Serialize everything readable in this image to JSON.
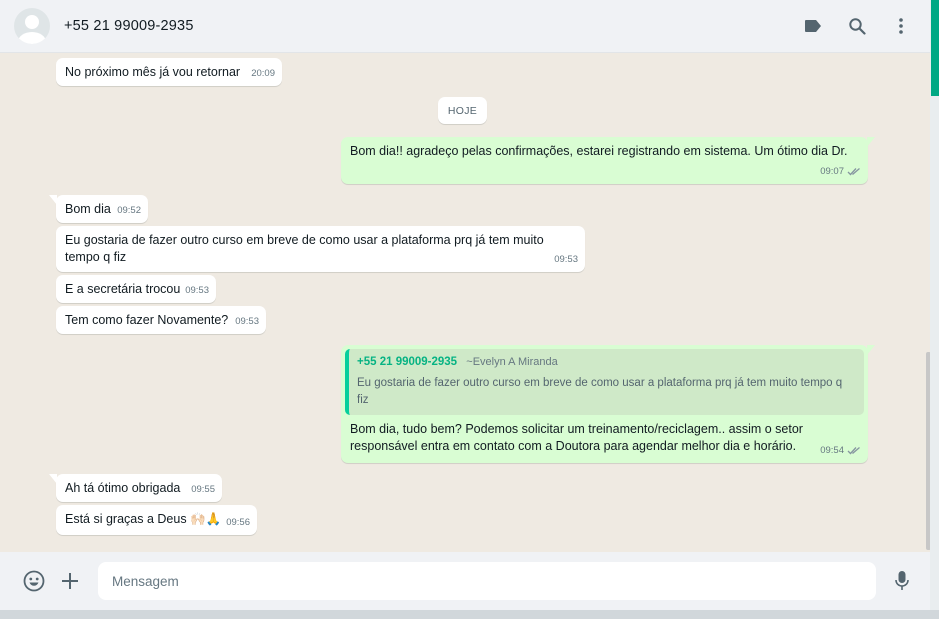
{
  "header": {
    "contact": "+55 21 99009-2935",
    "icons": [
      "label-icon",
      "search-icon",
      "menu-dots-icon"
    ]
  },
  "date_divider": "HOJE",
  "messages": [
    {
      "dir": "in",
      "text": "No próximo mês já vou retornar",
      "time": "20:09"
    },
    {
      "dir": "out",
      "text": "Bom dia!! agradeço pelas confirmações, estarei registrando em sistema. Um ótimo dia Dr.",
      "time": "09:07",
      "status": "read"
    },
    {
      "dir": "in",
      "text": "Bom dia",
      "time": "09:52"
    },
    {
      "dir": "in",
      "text": "Eu gostaria de fazer outro curso em breve de como usar a plataforma prq já tem muito tempo q fiz",
      "time": "09:53"
    },
    {
      "dir": "in",
      "text": "E a secretária trocou",
      "time": "09:53"
    },
    {
      "dir": "in",
      "text": "Tem como fazer Novamente?",
      "time": "09:53"
    },
    {
      "dir": "out",
      "quote": {
        "author": "+55 21 99009-2935",
        "pushname": "~Evelyn A Miranda",
        "text": "Eu gostaria de fazer outro curso em breve de como usar a plataforma prq já tem muito tempo q fiz"
      },
      "text": "Bom dia, tudo bem? Podemos solicitar um treinamento/reciclagem.. assim o setor responsável entra em contato com a Doutora para agendar melhor dia e horário.",
      "time": "09:54",
      "status": "read"
    },
    {
      "dir": "in",
      "text": "Ah tá ótimo obrigada",
      "time": "09:55"
    },
    {
      "dir": "in",
      "text": "Está si graças a Deus 🙌🏻🙏",
      "time": "09:56"
    }
  ],
  "composer": {
    "placeholder": "Mensagem",
    "icons": [
      "emoji-icon",
      "attach-plus-icon",
      "microphone-icon"
    ]
  },
  "colors": {
    "outgoing_bubble": "#d9fdd3",
    "incoming_bubble": "#ffffff",
    "chat_background": "#efeae2",
    "accent": "#00a884"
  }
}
